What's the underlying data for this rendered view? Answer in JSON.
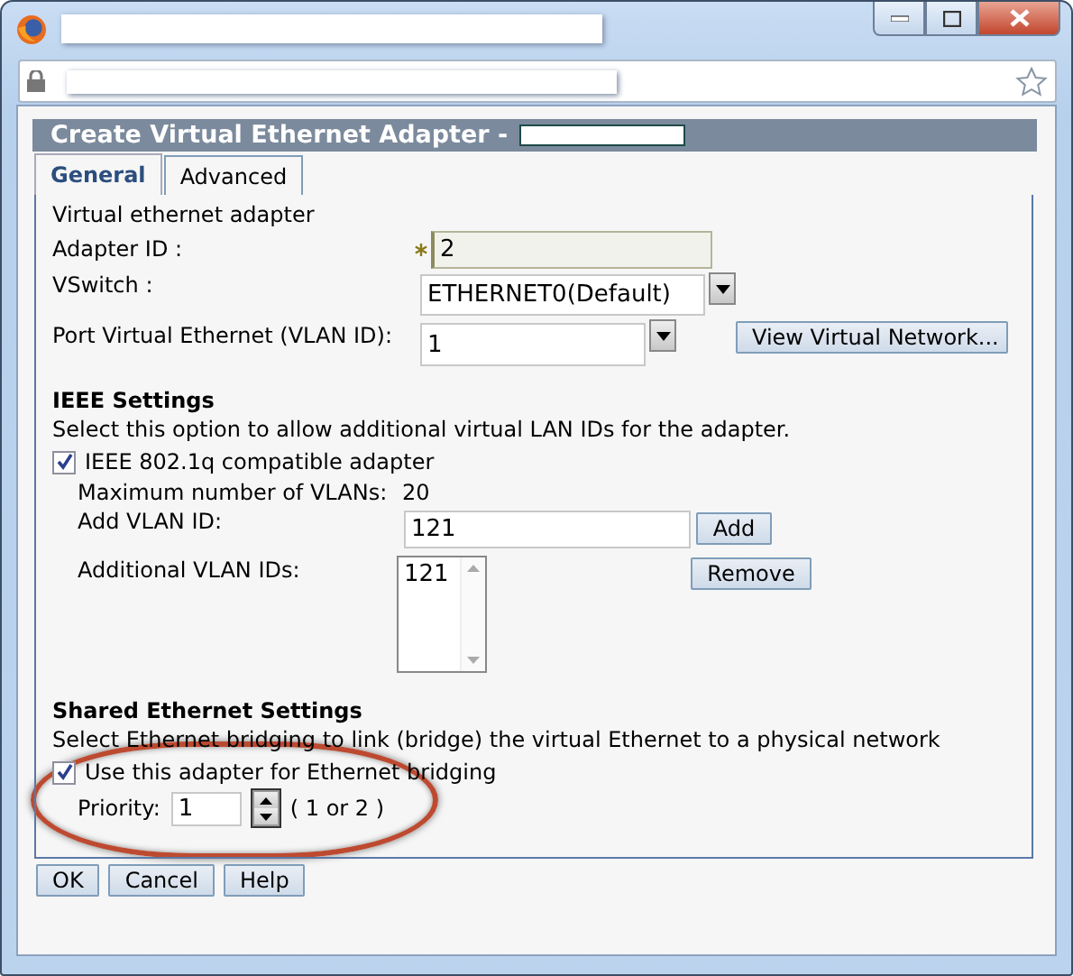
{
  "dialog": {
    "title": "Create Virtual Ethernet Adapter -"
  },
  "tabs": [
    {
      "label": "General",
      "selected": true
    },
    {
      "label": "Advanced",
      "selected": false
    }
  ],
  "general": {
    "section_label": "Virtual ethernet adapter",
    "adapter_id": {
      "label": "Adapter ID :",
      "value": "2",
      "required": true
    },
    "vswitch": {
      "label": "VSwitch :",
      "value": "ETHERNET0(Default)"
    },
    "port_vlan": {
      "label": "Port Virtual Ethernet (VLAN ID):",
      "value": "1",
      "button": "View Virtual Network..."
    }
  },
  "ieee": {
    "heading": "IEEE Settings",
    "description": "Select this option to allow additional virtual LAN IDs for the adapter.",
    "compatible": {
      "label": "IEEE 802.1q compatible adapter",
      "checked": true
    },
    "max_vlans": {
      "label": "Maximum number of VLANs:",
      "value": "20"
    },
    "add_vlan": {
      "label": "Add VLAN ID:",
      "value": "121",
      "button": "Add"
    },
    "additional": {
      "label": "Additional VLAN IDs:",
      "items": [
        "121"
      ],
      "button": "Remove"
    }
  },
  "shared": {
    "heading": "Shared Ethernet Settings",
    "description": "Select Ethernet bridging to link (bridge) the virtual Ethernet to a physical network",
    "bridging": {
      "label": "Use this adapter for Ethernet bridging",
      "checked": true
    },
    "priority": {
      "label": "Priority:",
      "value": "1",
      "hint": "( 1 or 2 )"
    }
  },
  "buttons": [
    "OK",
    "Cancel",
    "Help"
  ]
}
